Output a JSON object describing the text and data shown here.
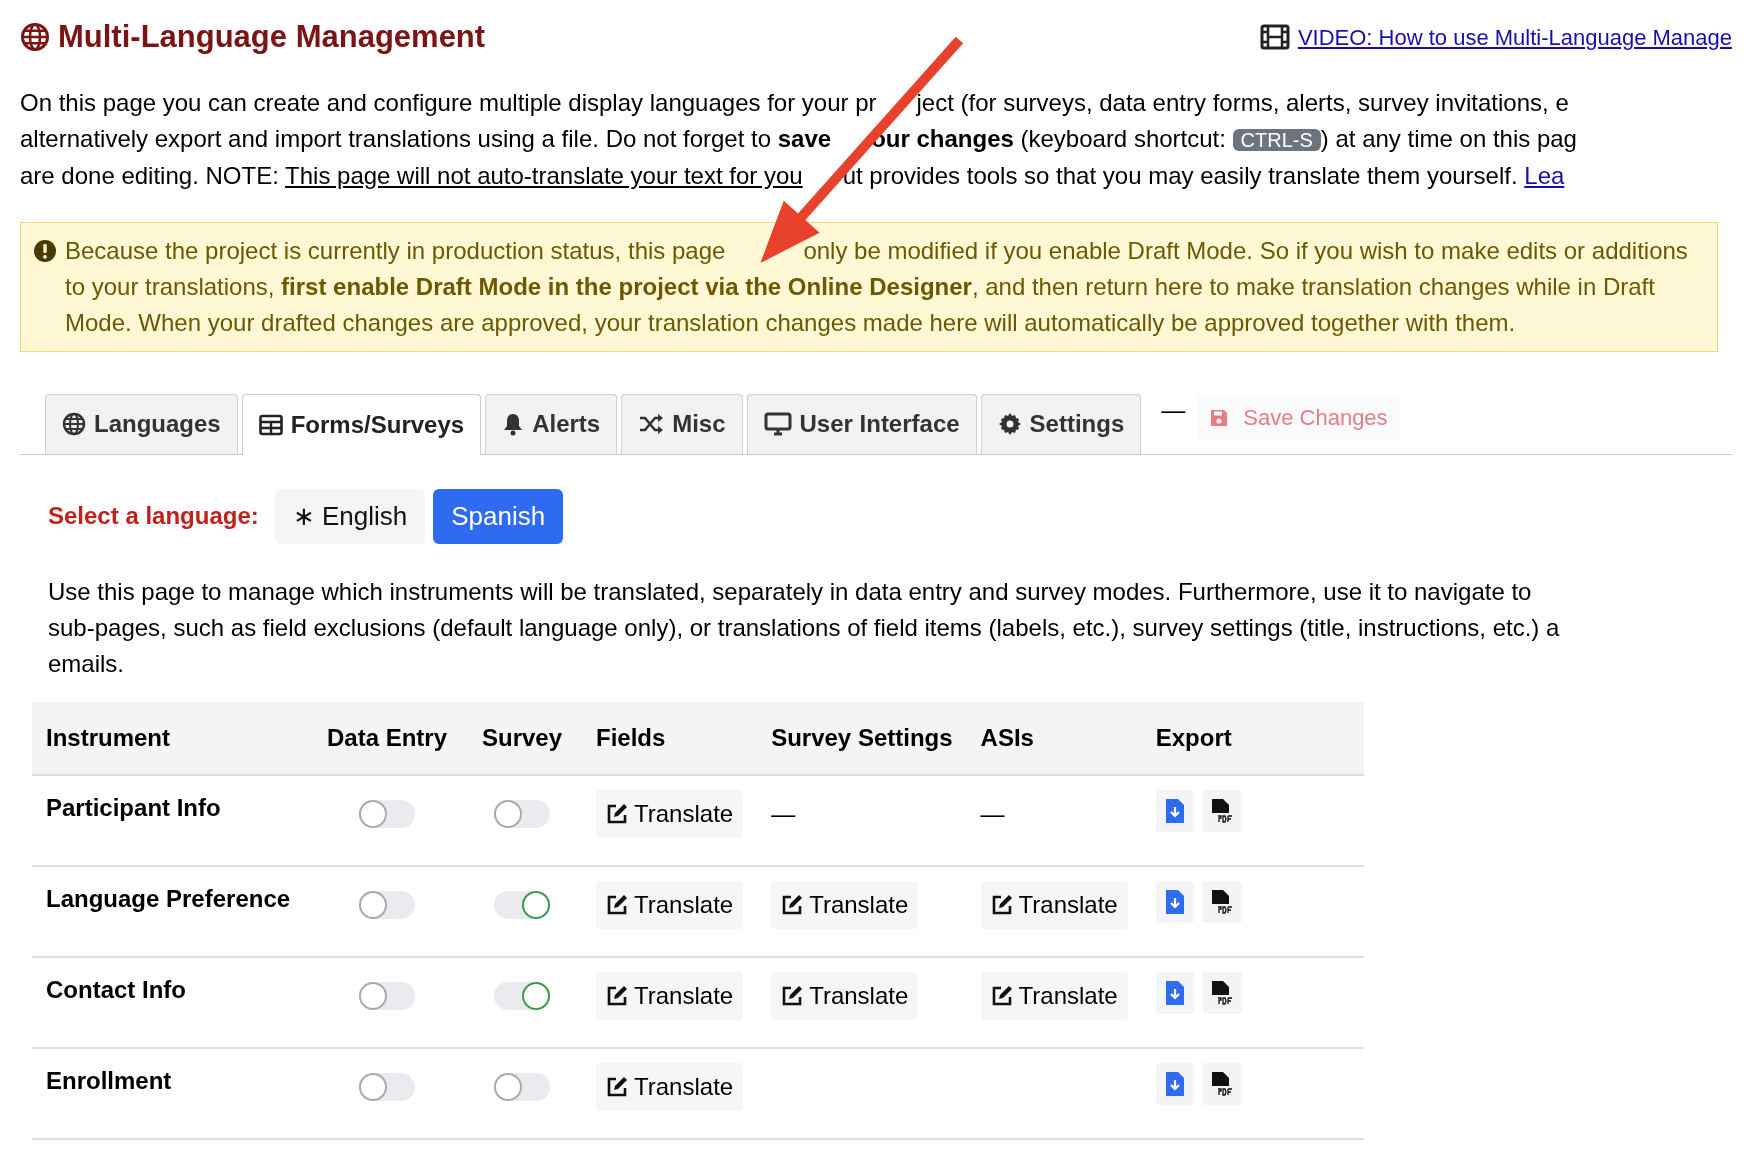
{
  "header": {
    "title": "Multi-Language Management",
    "video_link": "VIDEO: How to use Multi-Language Manage"
  },
  "intro_lines": [
    [
      {
        "kind": "text",
        "text": "On this page you can create and configure multiple display languages for your pr"
      },
      {
        "kind": "gap"
      },
      {
        "kind": "text",
        "text": "ject (for surveys, data entry forms, alerts, survey invitations, e"
      }
    ],
    [
      {
        "kind": "text",
        "text": "alternatively export and import translations using a file. Do not forget to **save**"
      },
      {
        "kind": "gap"
      },
      {
        "kind": "text",
        "text": "**our changes** (keyboard shortcut: "
      },
      {
        "kind": "kbd",
        "text": "CTRL-S"
      },
      {
        "kind": "text",
        "text": ") at any time on this pag"
      }
    ],
    [
      {
        "kind": "text",
        "text": "are done editing. NOTE: "
      },
      {
        "kind": "underline",
        "text": "This page will not auto-translate your text for you"
      },
      {
        "kind": "gap"
      },
      {
        "kind": "text",
        "text": "ut provides tools so that you may easily translate them yourself. "
      },
      {
        "kind": "link",
        "text": "Lea"
      }
    ]
  ],
  "alert": {
    "before_arrow": "Because the project is currently in production status, this page",
    "after_arrow": "only be modified if you enable Draft Mode. So if you wish to make edits or additions to your translations, **first enable Draft Mode in the project via the Online Designer**, and then return here to make translation changes while in Draft Mode. When your drafted changes are approved, your translation changes made here will automatically be approved together with them."
  },
  "tabs": [
    {
      "label": "Languages",
      "selected": false
    },
    {
      "label": "Forms/Surveys",
      "selected": true
    },
    {
      "label": "Alerts",
      "selected": false
    },
    {
      "label": "Misc",
      "selected": false
    },
    {
      "label": "User Interface",
      "selected": false
    },
    {
      "label": "Settings",
      "selected": false
    }
  ],
  "tab_separator": "—",
  "save_button": {
    "label": "Save Changes",
    "disabled": true
  },
  "language_select": {
    "label": "Select a language:",
    "languages": [
      {
        "label": "∗ English",
        "selected": false
      },
      {
        "label": "Spanish",
        "selected": true
      }
    ]
  },
  "description_lines": [
    "Use this page to manage which instruments will be translated, separately in data entry and survey modes. Furthermore, use it to navigate to",
    "sub-pages, such as field exclusions (default language only), or translations of field items (labels, etc.), survey settings (title, instructions, etc.) a",
    "emails."
  ],
  "table": {
    "columns": [
      "Instrument",
      "Data Entry",
      "Survey",
      "Fields",
      "Survey Settings",
      "ASIs",
      "Export"
    ],
    "rows": [
      {
        "instrument": "Participant Info",
        "data_entry": {
          "on": false
        },
        "survey": {
          "on": false
        },
        "fields": "Translate",
        "survey_settings": {
          "kind": "dash",
          "text": "—"
        },
        "asis": {
          "kind": "dash",
          "text": "—"
        }
      },
      {
        "instrument": "Language Preference",
        "data_entry": {
          "on": false
        },
        "survey": {
          "on": true
        },
        "fields": "Translate",
        "survey_settings": {
          "kind": "button",
          "text": "Translate"
        },
        "asis": {
          "kind": "button",
          "text": "Translate"
        }
      },
      {
        "instrument": "Contact Info",
        "data_entry": {
          "on": false
        },
        "survey": {
          "on": true
        },
        "fields": "Translate",
        "survey_settings": {
          "kind": "button",
          "text": "Translate"
        },
        "asis": {
          "kind": "button",
          "text": "Translate"
        }
      },
      {
        "instrument": "Enrollment",
        "data_entry": {
          "on": false
        },
        "survey": {
          "on": false
        },
        "fields": "Translate",
        "survey_settings": {
          "kind": "blank"
        },
        "asis": {
          "kind": "blank"
        }
      }
    ]
  }
}
